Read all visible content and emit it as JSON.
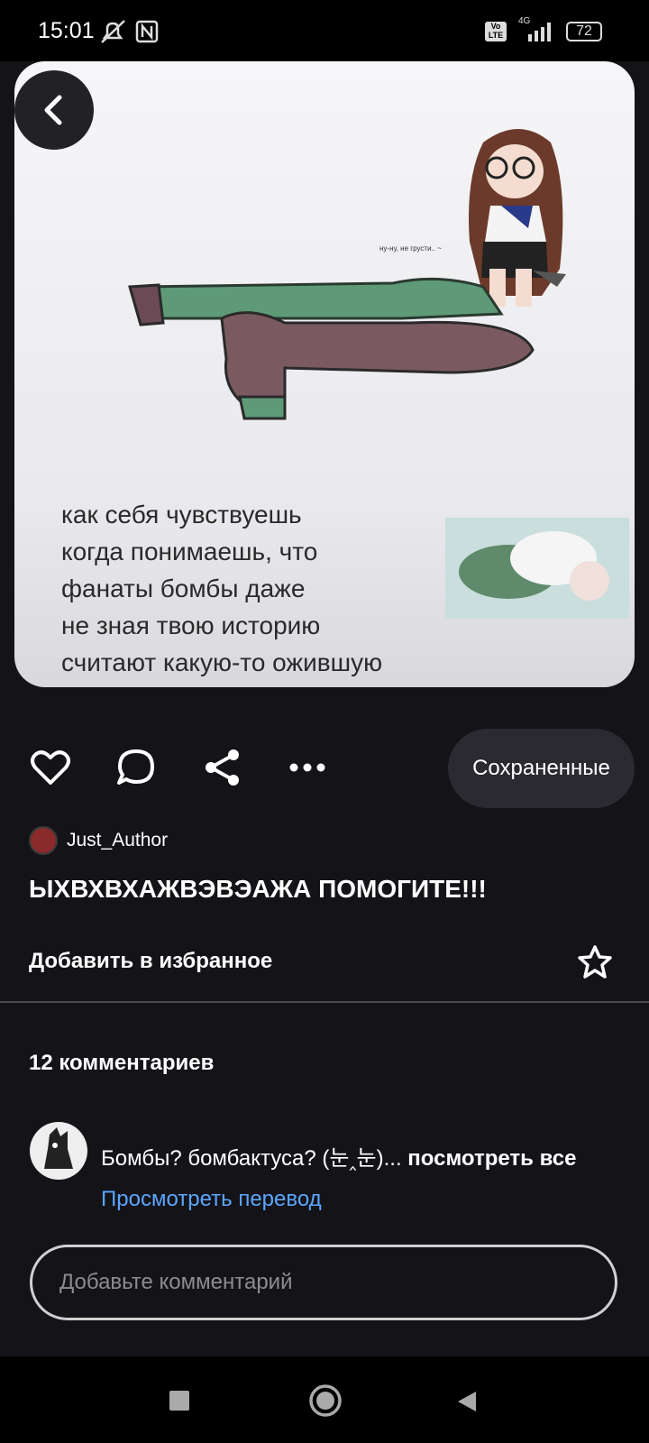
{
  "status_bar": {
    "time": "15:01",
    "battery": "72",
    "network": "4G",
    "volte": "Vo LTE"
  },
  "pin": {
    "overlay_whisper": "ну-ну, не грусти.. ~",
    "meme_text": "как себя чувствуешь\nкогда понимаешь, что\nфанаты бомбы даже\nне зная твою историю\nсчитают какую-то ожившую\nкотлету, интересней тебя:"
  },
  "actions": {
    "like_icon": "heart-icon",
    "comment_icon": "comment-bubble-icon",
    "share_icon": "share-icon",
    "more_icon": "more-dots-icon",
    "saved_label": "Сохраненные"
  },
  "author": {
    "name": "Just_Author"
  },
  "title": "ЫХВХВХАЖВЭВЭАЖА ПОМОГИТЕ!!!",
  "favorites": {
    "label": "Добавить в избранное"
  },
  "comments": {
    "count_label": "12 комментариев",
    "items": [
      {
        "text": "Бомбы? бомбактуса? (눈‸눈)...",
        "more": "посмотреть все",
        "translate": "Просмотреть перевод"
      }
    ],
    "input_placeholder": "Добавьте комментарий"
  },
  "colors": {
    "background": "#141318",
    "link": "#5aa6ff",
    "button": "#2b2a30"
  }
}
